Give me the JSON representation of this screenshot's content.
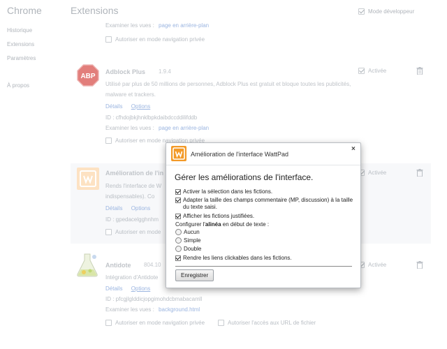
{
  "nav": {
    "title": "Chrome",
    "items": [
      "Historique",
      "Extensions",
      "Paramètres",
      "À propos"
    ]
  },
  "header": {
    "title": "Extensions",
    "devmode_label": "Mode développeur"
  },
  "top_partial": {
    "views_label": "Examiner les vues :",
    "views_link": "page en arrière-plan",
    "incognito_label": "Autoriser en mode navigation privée"
  },
  "adblock": {
    "logo_text": "ABP",
    "name": "Adblock Plus",
    "version": "1.9.4",
    "desc": "Utilisé par plus de 50 millions de personnes, Adblock Plus est gratuit et bloque toutes les publicités, malware et trackers.",
    "details": "Détails",
    "options": "Options",
    "id": "ID : cfhdojbkjhnklbpkdaibdccddilifddb",
    "views_label": "Examiner les vues :",
    "views_link": "page en arrière-plan",
    "incognito_label": "Autoriser en mode navigation privée",
    "enabled_label": "Activée"
  },
  "wattpad": {
    "name": "Amélioration de l'in",
    "desc1": "Rends l'interface de W",
    "desc2": "indispensables).  Co",
    "details": "Détails",
    "options": "Options",
    "id": "ID : gpedacelgghnhm",
    "incognito_label": "Autoriser en mode",
    "enabled_label": "Activée"
  },
  "antidote": {
    "name": "Antidote",
    "version": "804.10",
    "desc": "Intégration d'Antidote",
    "details": "Détails",
    "options": "Options",
    "id": "ID : pfcgjlglddicjopgimohdcbmabacamll",
    "views_label": "Examiner les vues :",
    "views_link": "background.html",
    "incognito_label": "Autoriser en mode navigation privée",
    "file_urls_label": "Autoriser l'accès aux URL de fichier",
    "enabled_label": "Activée"
  },
  "dialog": {
    "title": "Amélioration de l'interface WattPad",
    "close": "×",
    "heading": "Gérer les améliorations de l'interface.",
    "options": [
      "Activer la sélection dans les fictions.",
      "Adapter la taille des champs commentaire (MP, discussion) à la taille du texte saisi.",
      "Afficher les fictions justifiées."
    ],
    "indent_label_pre": "Configurer l'",
    "indent_label_bold": "alinéa",
    "indent_label_post": " en début de texte :",
    "radios": [
      "Aucun",
      "Simple",
      "Double"
    ],
    "links_option": "Rendre les liens clickables dans les fictions.",
    "save_button": "Enregistrer"
  },
  "colors": {
    "accent_orange": "#f39a28",
    "abp_red": "#d9534f",
    "link_blue": "#9bb5e0"
  }
}
